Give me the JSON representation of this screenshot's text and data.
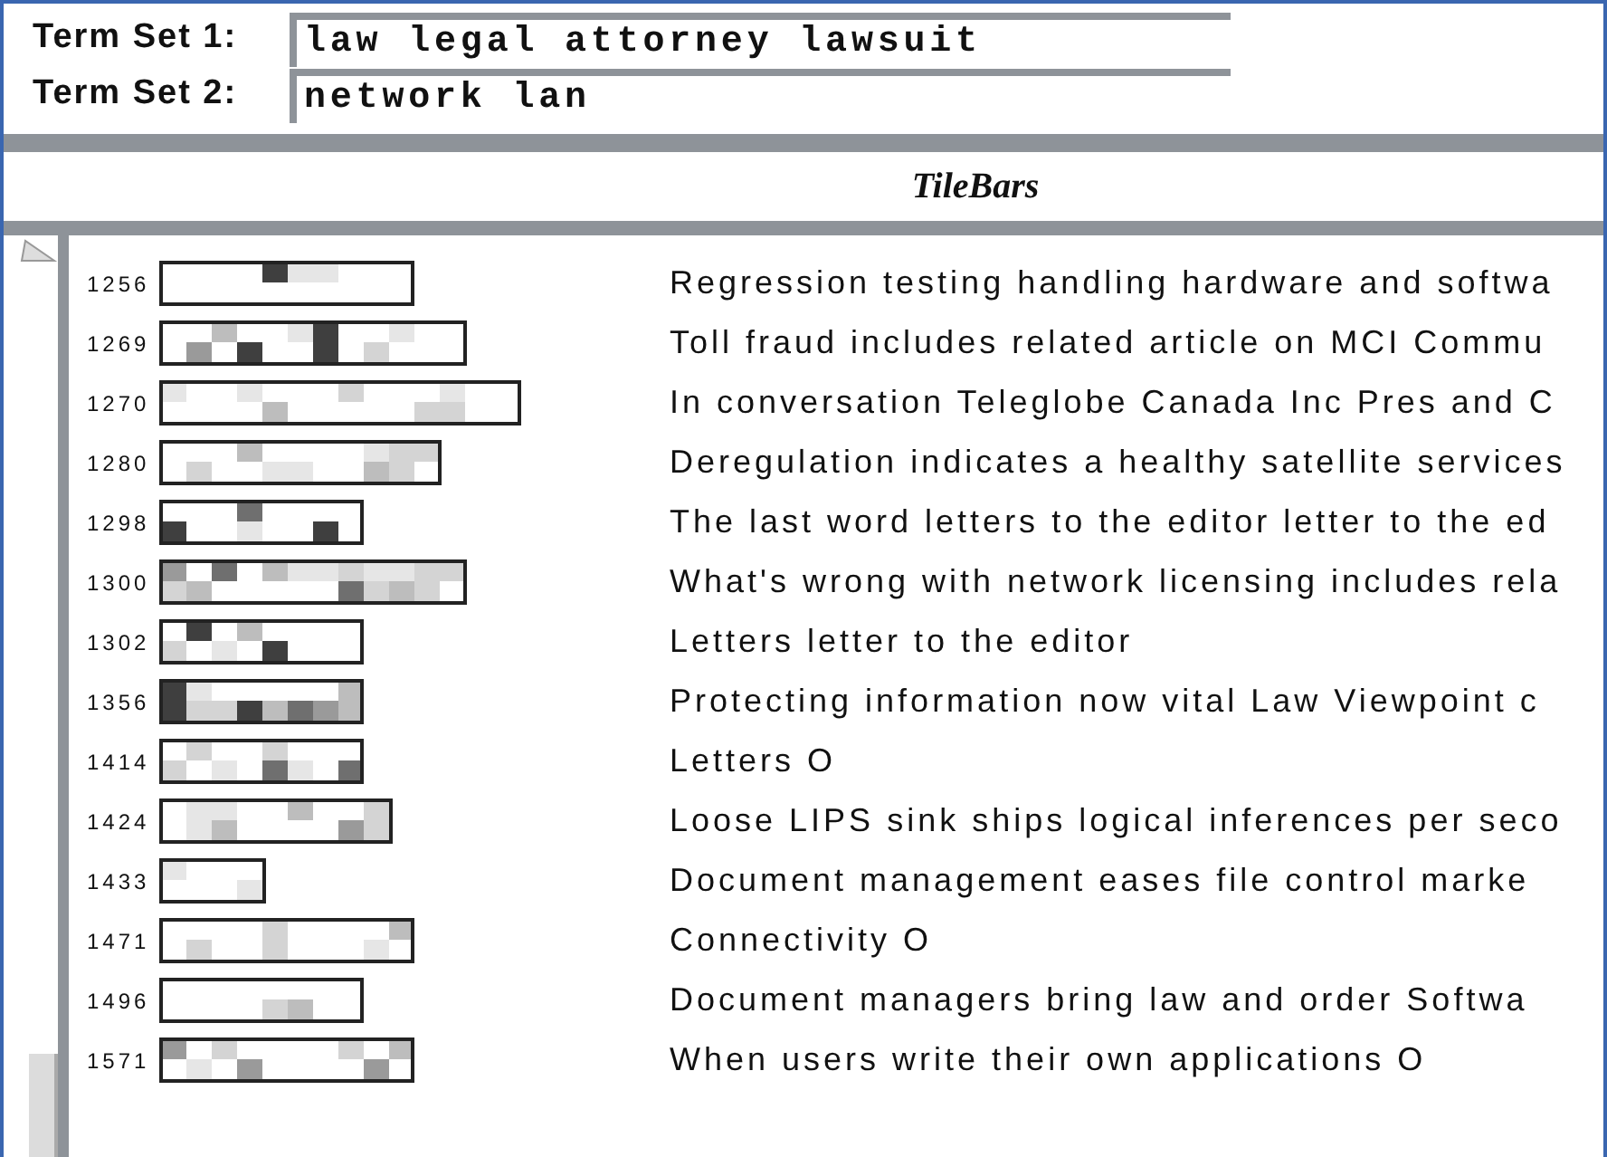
{
  "term_sets": [
    {
      "label": "Term Set 1:",
      "value": "law legal attorney lawsuit"
    },
    {
      "label": "Term Set 2:",
      "value": "network lan"
    }
  ],
  "title": "TileBars",
  "documents": [
    {
      "id": "1256",
      "title": "Regression testing handling hardware and softwa"
    },
    {
      "id": "1269",
      "title": "Toll fraud includes related article on MCI Commu"
    },
    {
      "id": "1270",
      "title": "In conversation Teleglobe Canada Inc Pres and C"
    },
    {
      "id": "1280",
      "title": "Deregulation indicates a healthy satellite services"
    },
    {
      "id": "1298",
      "title": "The last word letters to the editor letter to the ed"
    },
    {
      "id": "1300",
      "title": "What's wrong with network licensing includes rela"
    },
    {
      "id": "1302",
      "title": "Letters letter to the editor"
    },
    {
      "id": "1356",
      "title": "Protecting information now vital Law Viewpoint c"
    },
    {
      "id": "1414",
      "title": "Letters O"
    },
    {
      "id": "1424",
      "title": "Loose LIPS sink ships logical inferences per seco"
    },
    {
      "id": "1433",
      "title": "Document management eases file control marke"
    },
    {
      "id": "1471",
      "title": "Connectivity O"
    },
    {
      "id": "1496",
      "title": "Document managers bring law and order Softwa"
    },
    {
      "id": "1571",
      "title": "When users write their own applications O"
    }
  ]
}
